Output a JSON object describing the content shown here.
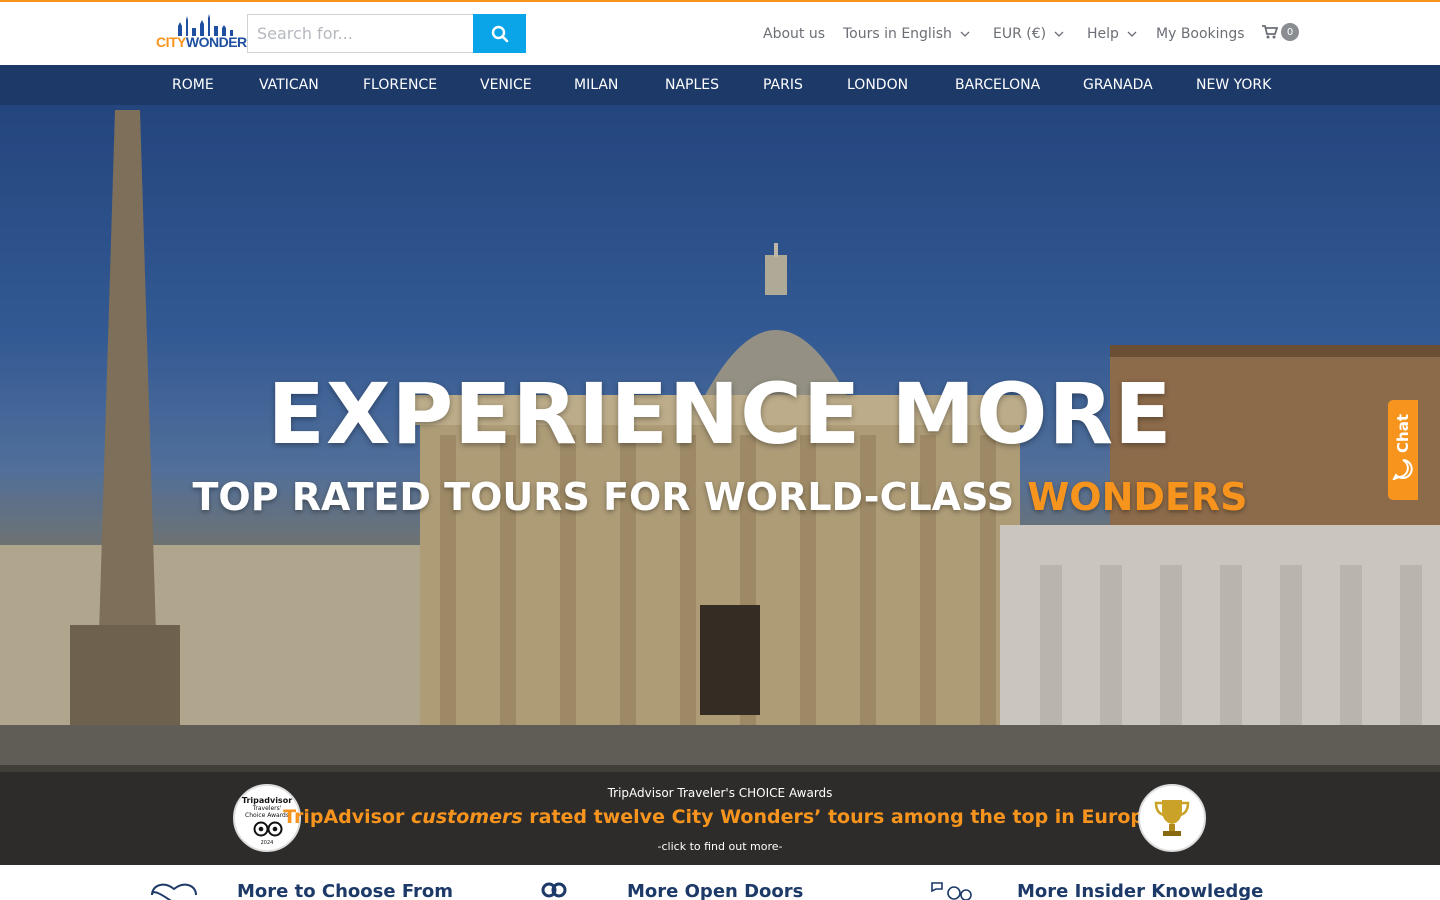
{
  "brand": {
    "logo_city": "CITY",
    "logo_wonders": "WONDERS",
    "accent_color": "#f7941d",
    "primary_color": "#1c3968",
    "search_button_color": "#0aa5e8"
  },
  "search": {
    "placeholder": "Search for...",
    "value": "",
    "icon": "search-icon"
  },
  "topnav": {
    "about": "About us",
    "tours_language": "Tours in English",
    "currency": "EUR (€)",
    "help": "Help",
    "bookings": "My Bookings",
    "cart_count": "0"
  },
  "cities": [
    "ROME",
    "VATICAN",
    "FLORENCE",
    "VENICE",
    "MILAN",
    "NAPLES",
    "PARIS",
    "LONDON",
    "BARCELONA",
    "GRANADA",
    "NEW YORK"
  ],
  "hero": {
    "title": "EXPERIENCE MORE",
    "subtitle_main": "TOP RATED TOURS FOR WORLD-CLASS ",
    "subtitle_accent": "WONDERS"
  },
  "award": {
    "heading": "TripAdvisor Traveler's CHOICE Awards",
    "line_prefix": "TripAdvisor ",
    "line_em": "customers",
    "line_suffix": " rated twelve City Wonders’ tours among the top in Europe",
    "click": "-click to find out more-",
    "badge_brand": "Tripadvisor",
    "badge_line1": "Travelers'",
    "badge_line2": "Choice Awards",
    "badge_year": "2024"
  },
  "chat": {
    "label": "Chat"
  },
  "features": [
    {
      "title": "More to Choose From",
      "icon": "heart-icon"
    },
    {
      "title": "More Open Doors",
      "icon": "keys-icon"
    },
    {
      "title": "More Insider Knowledge",
      "icon": "guide-icon"
    }
  ]
}
